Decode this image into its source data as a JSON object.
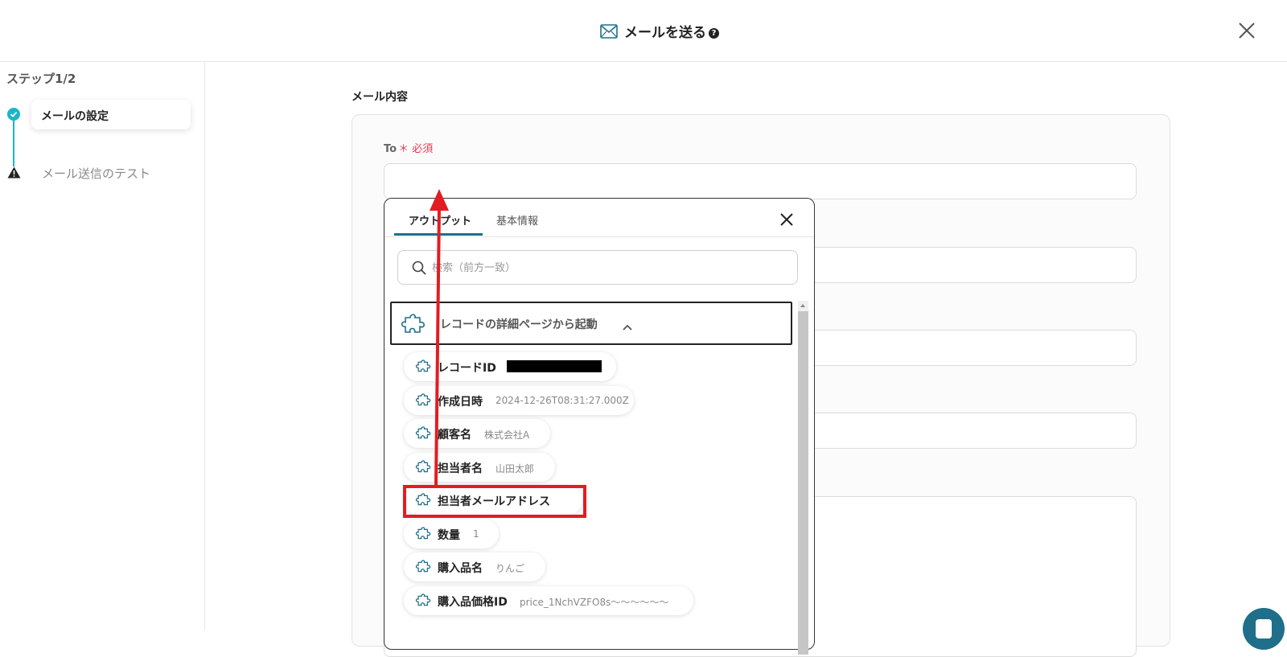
{
  "header": {
    "title": "メールを送る",
    "help_icon": "?"
  },
  "sidebar": {
    "step_label": "ステップ1/2",
    "steps": [
      {
        "label": "メールの設定",
        "status": "complete"
      },
      {
        "label": "メール送信のテスト",
        "status": "warning"
      }
    ]
  },
  "main": {
    "section_title": "メール内容",
    "to_label": "To",
    "required_mark": "＊ 必須"
  },
  "popup": {
    "tabs": [
      {
        "label": "アウトプット",
        "active": true
      },
      {
        "label": "基本情報",
        "active": false
      }
    ],
    "search_placeholder": "検索（前方一致）",
    "group_label": "レコードの詳細ページから起動",
    "items": [
      {
        "label": "レコードID",
        "value": ""
      },
      {
        "label": "作成日時",
        "value": "2024-12-26T08:31:27.000Z"
      },
      {
        "label": "顧客名",
        "value": "株式会社A"
      },
      {
        "label": "担当者名",
        "value": "山田太郎"
      },
      {
        "label": "担当者メールアドレス",
        "value": ""
      },
      {
        "label": "数量",
        "value": "1"
      },
      {
        "label": "購入品名",
        "value": "りんご"
      },
      {
        "label": "購入品価格ID",
        "value": "price_1NchVZFO8s〜〜〜〜〜〜"
      }
    ]
  },
  "colors": {
    "accent": "#1ab6c8",
    "tab_underline": "#1f6f8b",
    "required": "#e83a4f",
    "annotation": "#e11d23"
  }
}
